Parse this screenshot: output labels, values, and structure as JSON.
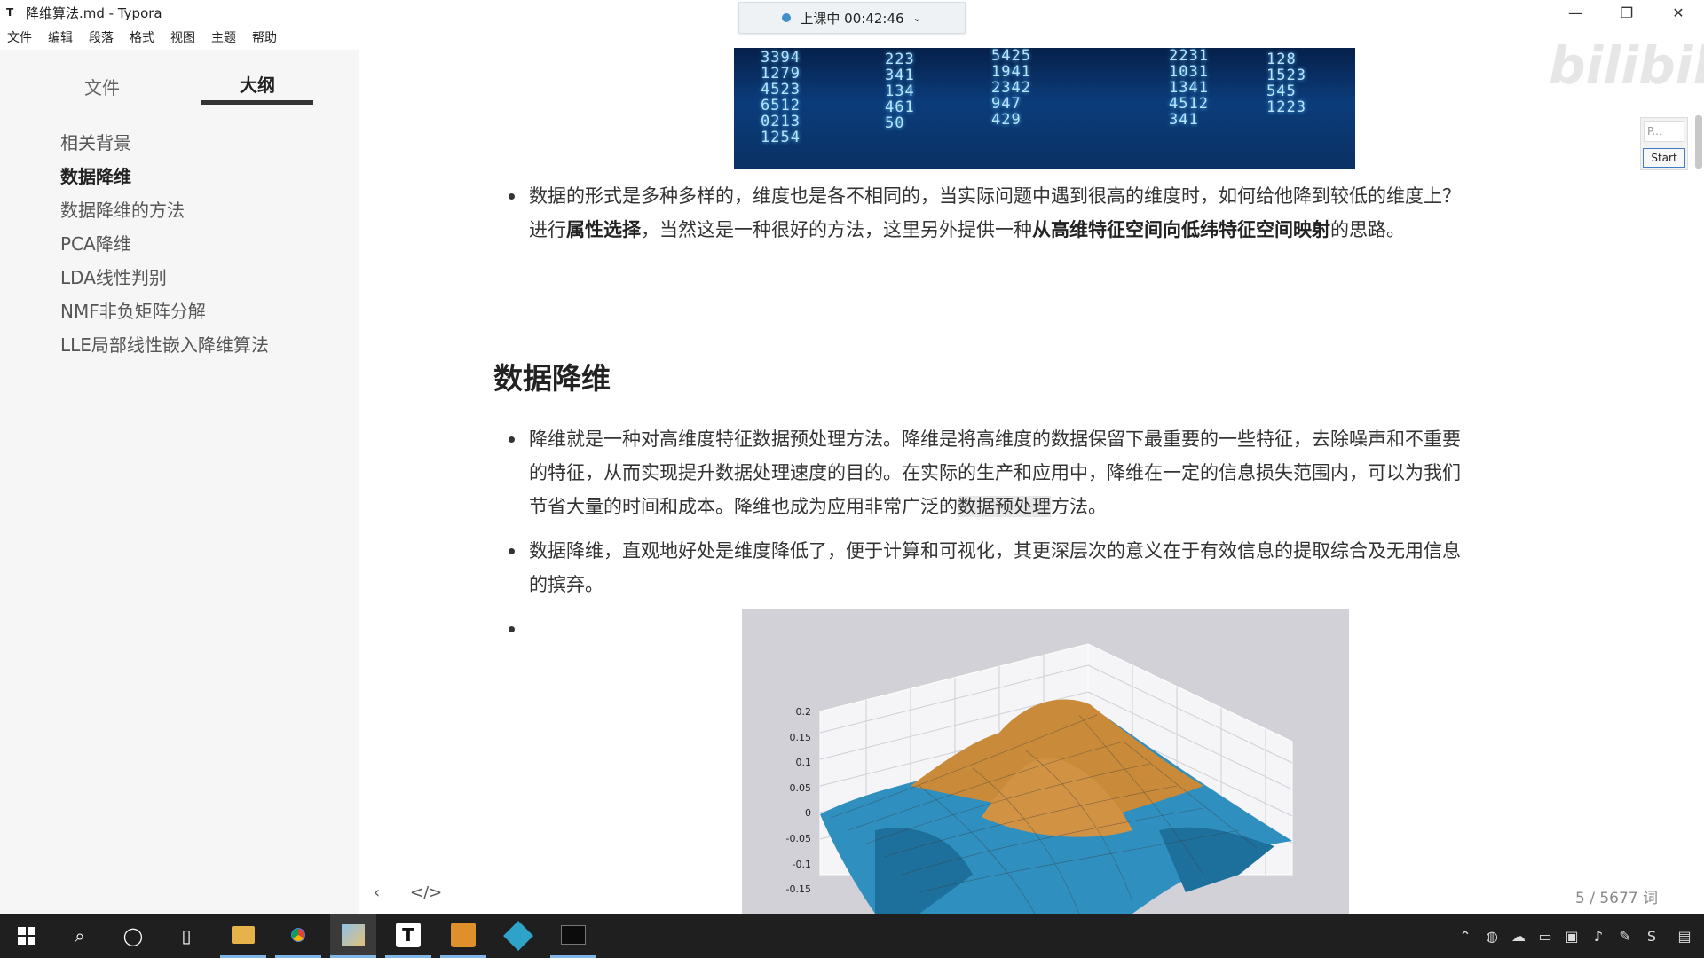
{
  "window": {
    "title": "降维算法.md - Typora",
    "app_icon": "T",
    "controls": [
      "—",
      "❐",
      "✕"
    ]
  },
  "menu": [
    "文件",
    "编辑",
    "段落",
    "格式",
    "视图",
    "主题",
    "帮助"
  ],
  "class_status": {
    "label": "上课中 00:42:46"
  },
  "sidebar": {
    "tabs": [
      "文件",
      "大纲"
    ],
    "active_tab": "大纲",
    "outline": [
      "相关背景",
      "数据降维",
      "数据降维的方法",
      "PCA降维",
      "LDA线性判别",
      "NMF非负矩阵分解",
      "LLE局部线性嵌入降维算法"
    ],
    "current_item": "数据降维"
  },
  "top_image": {
    "columns": [
      "3394\n1279\n4523\n6512\n0213\n1254",
      "223\n341\n134\n461\n50",
      "5425\n1941\n2342\n947\n429",
      "2231\n1031\n1341\n4512\n341",
      "128\n1523\n545\n1223"
    ]
  },
  "paragraph1": {
    "parts": [
      "数据的形式是多种多样的，维度也是各不相同的，当实际问题中遇到很高的维度时，如何给他降到较低的维度上？进行",
      "属性选择",
      "，当然这是一种很好的方法，这里另外提供一种",
      "从高维特征空间向低纬特征空间映射",
      "的思路。"
    ]
  },
  "section_heading": "数据降维",
  "bullets": {
    "b1_pre": "降维就是一种对高维度特征数据预处理方法。降维是将高维度的数据保留下最重要的一些特征，去除噪声和不重要的特征，从而实现提升数据处理速度的目的。在实际的生产和应用中，降维在一定的信息损失范围内，可以为我们节省大量的时间和成本。降维也成为应用非常广泛的",
    "b1_hl": "数据预处理",
    "b1_post": "方法。",
    "b2": "数据降维，直观地好处是维度降低了，便于计算和可视化，其更深层次的意义在于有效信息的提取综合及无用信息的摈弃。",
    "b3": ""
  },
  "plot": {
    "z_ticks": [
      "0.2",
      "0.15",
      "0.1",
      "0.05",
      "0",
      "-0.05",
      "-0.1",
      "-0.15"
    ]
  },
  "editor_footer": {
    "prev": "‹",
    "source": "</>",
    "wordcount": "5 / 5677 词"
  },
  "widget": {
    "placeholder": "P...",
    "start_label": "Start"
  },
  "watermark": "bilibili",
  "taskbar": {
    "items": [
      "windows-icon",
      "search-icon",
      "cortana-icon",
      "task-view-icon",
      "file-explorer-icon",
      "chrome-icon",
      "paint-icon",
      "typora-icon",
      "pycharm-icon",
      "vm-icon",
      "terminal-icon"
    ]
  }
}
